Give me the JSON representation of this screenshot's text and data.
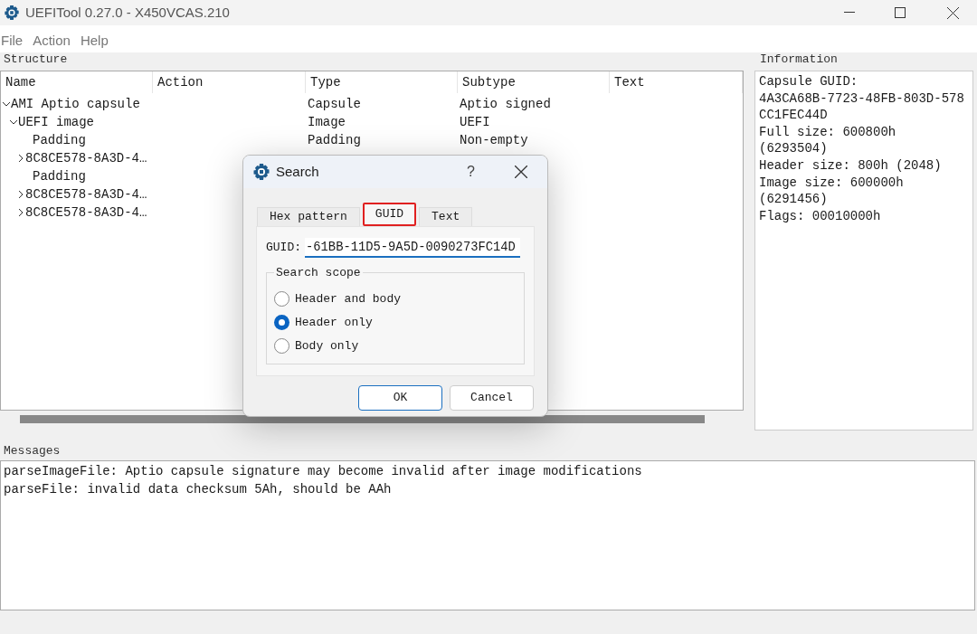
{
  "window": {
    "title": "UEFITool 0.27.0 - X450VCAS.210"
  },
  "menu": [
    "File",
    "Action",
    "Help"
  ],
  "structure": {
    "title": "Structure",
    "columns": [
      "Name",
      "Action",
      "Type",
      "Subtype",
      "Text"
    ],
    "tree": [
      {
        "name": "AMI Aptio capsule",
        "type": "Capsule",
        "subtype": "Aptio signed",
        "expanded": true,
        "children": [
          {
            "name": "UEFI image",
            "type": "Image",
            "subtype": "UEFI",
            "expanded": true,
            "children": [
              {
                "name": "Padding",
                "type": "Padding",
                "subtype": "Non-empty"
              },
              {
                "name": "8C8CE578-8A3D-4…",
                "expanded": false
              },
              {
                "name": "Padding"
              },
              {
                "name": "8C8CE578-8A3D-4…",
                "expanded": false
              },
              {
                "name": "8C8CE578-8A3D-4…",
                "expanded": false
              }
            ]
          }
        ]
      }
    ]
  },
  "information": {
    "title": "Information",
    "lines": [
      "Capsule GUID:",
      "4A3CA68B-7723-48FB-803D-578",
      "CC1FEC44D",
      "Full size: 600800h",
      "(6293504)",
      "Header size: 800h (2048)",
      "Image size: 600000h",
      "(6291456)",
      "Flags: 00010000h"
    ]
  },
  "messages": {
    "title": "Messages",
    "lines": [
      "parseImageFile: Aptio capsule signature may become invalid after image modifications",
      "parseFile: invalid data checksum 5Ah, should be AAh"
    ]
  },
  "dialog": {
    "title": "Search",
    "help": "?",
    "tabs": [
      {
        "label": "Hex pattern",
        "selected": false
      },
      {
        "label": "GUID",
        "selected": true
      },
      {
        "label": "Text",
        "selected": false
      }
    ],
    "guid_label": "GUID:",
    "guid_value": "-61BB-11D5-9A5D-0090273FC14D",
    "scope": {
      "title": "Search scope",
      "options": [
        {
          "label": "Header and body",
          "selected": false
        },
        {
          "label": "Header only",
          "selected": true
        },
        {
          "label": "Body only",
          "selected": false
        }
      ]
    },
    "buttons": [
      "OK",
      "Cancel"
    ]
  }
}
